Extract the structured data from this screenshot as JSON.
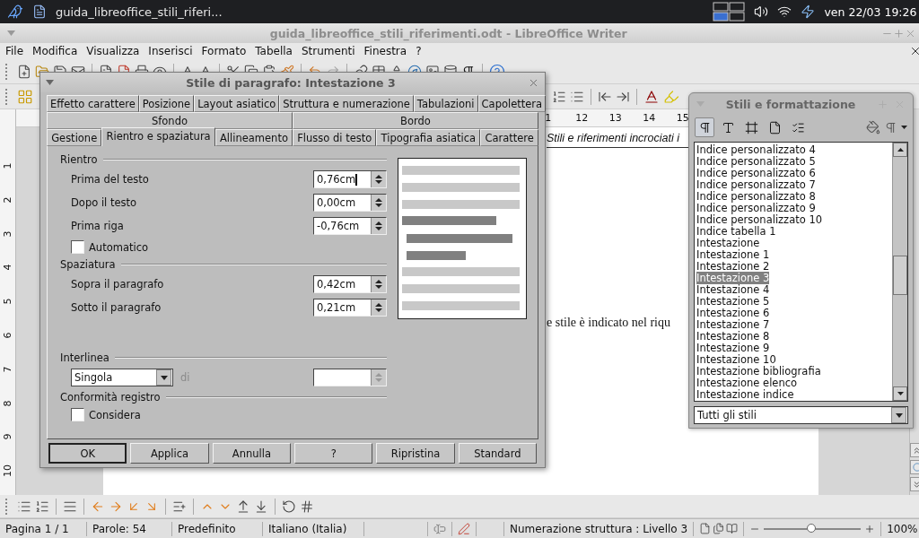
{
  "top_panel": {
    "task_title": "guida_libreoffice_stili_riferi...",
    "clock": "ven 22/03 19:26"
  },
  "window": {
    "title": "guida_libreoffice_stili_riferimenti.odt - LibreOffice Writer"
  },
  "menu": [
    "File",
    "Modifica",
    "Visualizza",
    "Inserisci",
    "Formato",
    "Tabella",
    "Strumenti",
    "Finestra",
    "?"
  ],
  "ruler": [
    "1",
    "12",
    "13",
    "14",
    "15"
  ],
  "vertical_ruler": [
    "1",
    "2",
    "3",
    "4",
    "5",
    "6",
    "7",
    "8",
    "9",
    "10"
  ],
  "document": {
    "header": "Stili e riferimenti incrociati i",
    "body": "e stile è indicato nel riqu"
  },
  "dialog": {
    "title": "Stile di paragrafo: Intestazione 3",
    "tab_rows": [
      [
        {
          "label": "Effetto carattere",
          "selected": false
        },
        {
          "label": "Posizione",
          "selected": false
        },
        {
          "label": "Layout asiatico",
          "selected": false
        },
        {
          "label": "Struttura e numerazione",
          "selected": false
        },
        {
          "label": "Tabulazioni",
          "selected": false
        },
        {
          "label": "Capolettera",
          "selected": false
        }
      ],
      [
        {
          "label": "Sfondo",
          "selected": false
        },
        {
          "label": "Bordo",
          "selected": false
        }
      ],
      [
        {
          "label": "Gestione",
          "selected": false
        },
        {
          "label": "Rientro e spaziatura",
          "selected": true
        },
        {
          "label": "Allineamento",
          "selected": false
        },
        {
          "label": "Flusso di testo",
          "selected": false
        },
        {
          "label": "Tipografia asiatica",
          "selected": false
        },
        {
          "label": "Carattere",
          "selected": false
        }
      ]
    ],
    "sections": [
      {
        "title": "Rientro",
        "rows": [
          {
            "kind": "spin",
            "label": "Prima del testo",
            "value": "0,76cm",
            "focused": true
          },
          {
            "kind": "spin",
            "label": "Dopo il testo",
            "value": "0,00cm",
            "focused": false
          },
          {
            "kind": "spin",
            "label": "Prima riga",
            "value": "-0,76cm",
            "focused": false
          },
          {
            "kind": "checkbox",
            "label": "Automatico",
            "checked": false
          }
        ]
      },
      {
        "title": "Spaziatura",
        "rows": [
          {
            "kind": "spin",
            "label": "Sopra il paragrafo",
            "value": "0,42cm",
            "focused": false
          },
          {
            "kind": "spin",
            "label": "Sotto il paragrafo",
            "value": "0,21cm",
            "focused": false
          }
        ]
      },
      {
        "title": "Interlinea",
        "rows": [
          {
            "kind": "line_spacing",
            "value": "Singola",
            "label": "di",
            "disabled": true
          }
        ]
      },
      {
        "title": "Conformità registro",
        "rows": [
          {
            "kind": "checkbox",
            "label": "Considera",
            "checked": false
          }
        ]
      }
    ],
    "buttons": [
      {
        "label": "OK",
        "default": true
      },
      {
        "label": "Applica",
        "default": false
      },
      {
        "label": "Annulla",
        "default": false
      },
      {
        "label": "?",
        "default": false
      },
      {
        "label": "Ripristina",
        "default": false
      },
      {
        "label": "Standard",
        "default": false
      }
    ]
  },
  "styles_panel": {
    "title": "Stili e formattazione",
    "families": [
      {
        "kind": "paragraph",
        "selected": true
      },
      {
        "kind": "character",
        "selected": false
      },
      {
        "kind": "frame",
        "selected": false
      },
      {
        "kind": "page",
        "selected": false
      },
      {
        "kind": "list",
        "selected": false
      }
    ],
    "items": [
      {
        "label": "Indice personalizzato 4",
        "selected": false
      },
      {
        "label": "Indice personalizzato 5",
        "selected": false
      },
      {
        "label": "Indice personalizzato 6",
        "selected": false
      },
      {
        "label": "Indice personalizzato 7",
        "selected": false
      },
      {
        "label": "Indice personalizzato 8",
        "selected": false
      },
      {
        "label": "Indice personalizzato 9",
        "selected": false
      },
      {
        "label": "Indice personalizzato 10",
        "selected": false
      },
      {
        "label": "Indice tabella 1",
        "selected": false
      },
      {
        "label": "Intestazione",
        "selected": false
      },
      {
        "label": "Intestazione 1",
        "selected": false
      },
      {
        "label": "Intestazione 2",
        "selected": false
      },
      {
        "label": "Intestazione 3",
        "selected": true
      },
      {
        "label": "Intestazione 4",
        "selected": false
      },
      {
        "label": "Intestazione 5",
        "selected": false
      },
      {
        "label": "Intestazione 6",
        "selected": false
      },
      {
        "label": "Intestazione 7",
        "selected": false
      },
      {
        "label": "Intestazione 8",
        "selected": false
      },
      {
        "label": "Intestazione 9",
        "selected": false
      },
      {
        "label": "Intestazione 10",
        "selected": false
      },
      {
        "label": "Intestazione bibliografia",
        "selected": false
      },
      {
        "label": "Intestazione elenco",
        "selected": false
      },
      {
        "label": "Intestazione indice",
        "selected": false
      }
    ],
    "filter": "Tutti gli stili"
  },
  "status_bar": {
    "page": "Pagina 1 / 1",
    "words": "Parole: 54",
    "page_style": "Predefinito",
    "language": "Italiano (Italia)",
    "outline": "Numerazione struttura : Livello 3",
    "zoom": {
      "level": 0.5,
      "reading": "100%"
    }
  }
}
